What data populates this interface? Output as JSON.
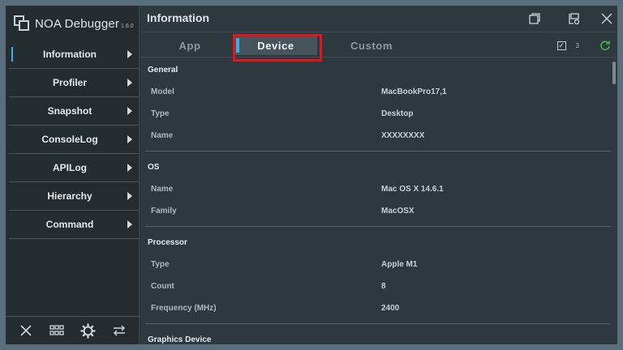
{
  "app": {
    "name": "NOA Debugger",
    "version": "1.8.0"
  },
  "sidebar": {
    "items": [
      {
        "label": "Information",
        "name": "information"
      },
      {
        "label": "Profiler",
        "name": "profiler"
      },
      {
        "label": "Snapshot",
        "name": "snapshot"
      },
      {
        "label": "ConsoleLog",
        "name": "consolelog"
      },
      {
        "label": "APILog",
        "name": "apilog"
      },
      {
        "label": "Hierarchy",
        "name": "hierarchy"
      },
      {
        "label": "Command",
        "name": "command"
      }
    ],
    "active": "Information",
    "bottom_icons": [
      "close-icon",
      "grid-icon",
      "gear-icon",
      "swap-arrows-icon"
    ]
  },
  "header": {
    "title": "Information",
    "window_icons": [
      "float-window-icon",
      "dock-settings-icon",
      "close-icon"
    ]
  },
  "tabs": {
    "app": "App",
    "device": "Device",
    "custom": "Custom",
    "selected": "Device"
  },
  "toolbar": {
    "checkbox_checked": true,
    "count": "3",
    "refresh_icon": "refresh-icon"
  },
  "sections": {
    "general": {
      "title": "General",
      "rows": [
        {
          "key": "Model",
          "value": "MacBookPro17,1"
        },
        {
          "key": "Type",
          "value": "Desktop"
        },
        {
          "key": "Name",
          "value": "XXXXXXXX"
        }
      ]
    },
    "os": {
      "title": "OS",
      "rows": [
        {
          "key": "Name",
          "value": "Mac OS X 14.6.1"
        },
        {
          "key": "Family",
          "value": "MacOSX"
        }
      ]
    },
    "processor": {
      "title": "Processor",
      "rows": [
        {
          "key": "Type",
          "value": "Apple M1"
        },
        {
          "key": "Count",
          "value": "8"
        },
        {
          "key": "Frequency (MHz)",
          "value": "2400"
        }
      ]
    },
    "graphics": {
      "title": "Graphics Device"
    }
  },
  "colors": {
    "accent": "#31b6e7",
    "highlight": "#e3141a",
    "refresh": "#3ec13e"
  }
}
